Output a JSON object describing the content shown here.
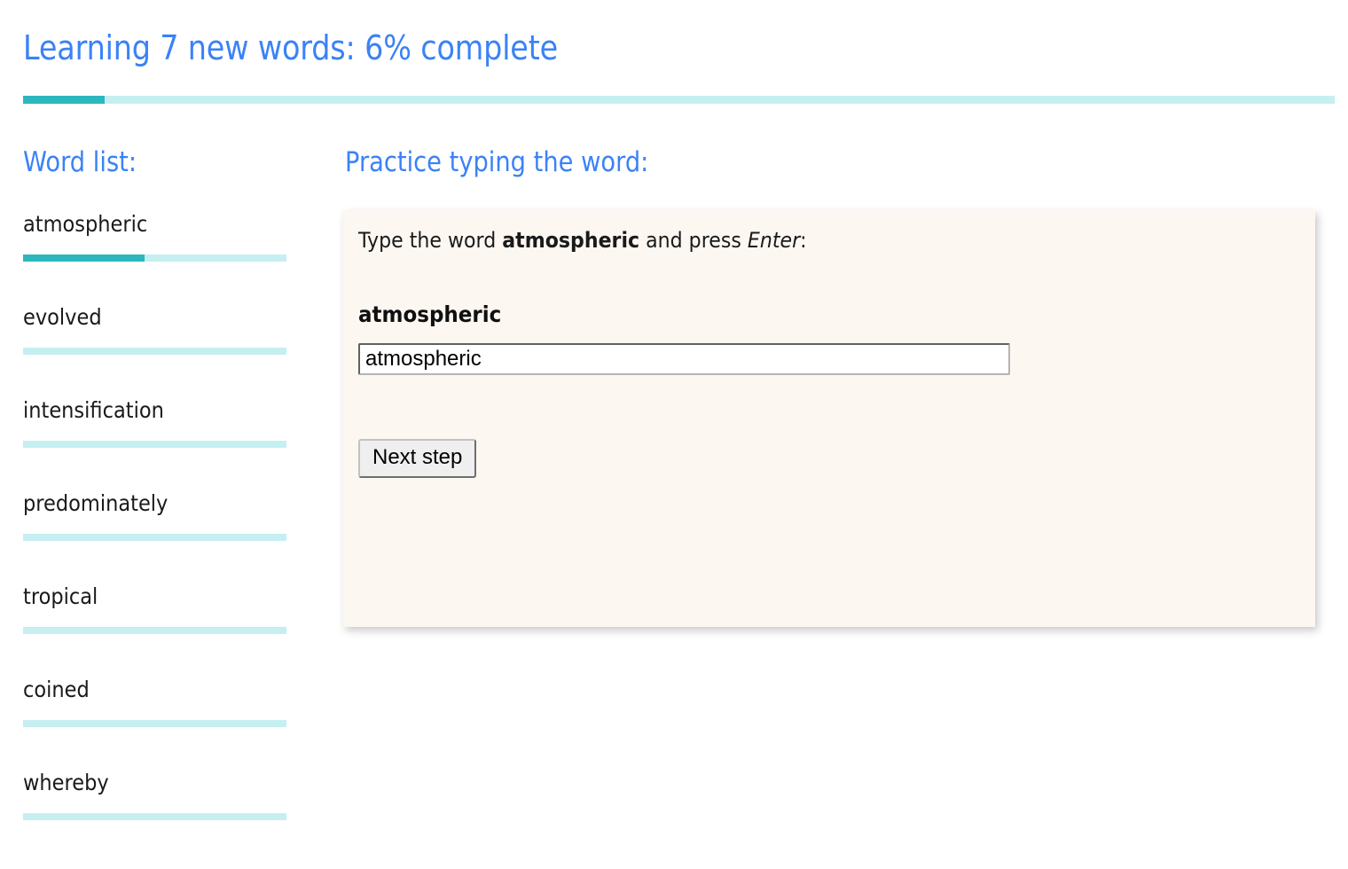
{
  "header": {
    "title": "Learning 7 new words: 6% complete",
    "progress_percent": 6,
    "progress_fill_ratio": 0.062,
    "title_color": "#3b82f6",
    "bar_fill_color": "#2bb7bd",
    "bar_track_color": "#c5eff0"
  },
  "word_list": {
    "heading": "Word list:",
    "items": [
      {
        "word": "atmospheric",
        "progress_ratio": 0.46
      },
      {
        "word": "evolved",
        "progress_ratio": 0
      },
      {
        "word": "intensification",
        "progress_ratio": 0
      },
      {
        "word": "predominately",
        "progress_ratio": 0
      },
      {
        "word": "tropical",
        "progress_ratio": 0
      },
      {
        "word": "coined",
        "progress_ratio": 0
      },
      {
        "word": "whereby",
        "progress_ratio": 0
      }
    ]
  },
  "practice": {
    "heading": "Practice typing the word:",
    "prompt_prefix": "Type the word ",
    "prompt_word": "atmospheric",
    "prompt_middle": " and press ",
    "prompt_key": "Enter",
    "prompt_suffix": ":",
    "target_word": "atmospheric",
    "input_value": "atmospheric",
    "input_placeholder": "",
    "next_button_label": "Next step",
    "panel_background": "#fdf7f1"
  }
}
